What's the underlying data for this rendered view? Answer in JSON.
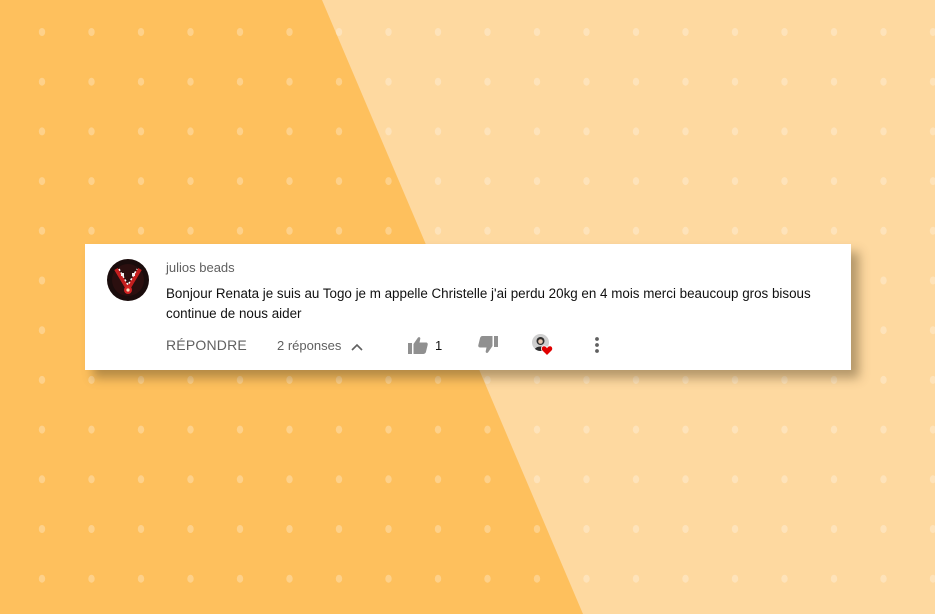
{
  "comment": {
    "author": "julios beads",
    "text": "Bonjour Renata je suis au Togo je m appelle Christelle j'ai perdu 20kg en 4 mois merci beaucoup gros bisous continue de nous aider",
    "reply_label": "RÉPONDRE",
    "replies_label": "2 réponses",
    "like_count": "1"
  },
  "colors": {
    "bg_dark": "#fec05d",
    "bg_light": "#fed9a0",
    "heart": "#e00000",
    "icon": "#909090"
  },
  "icons": {
    "chevron": "chevron-up-icon",
    "like": "thumbs-up-icon",
    "dislike": "thumbs-down-icon",
    "heart": "creator-heart-icon",
    "more": "more-vert-icon"
  }
}
